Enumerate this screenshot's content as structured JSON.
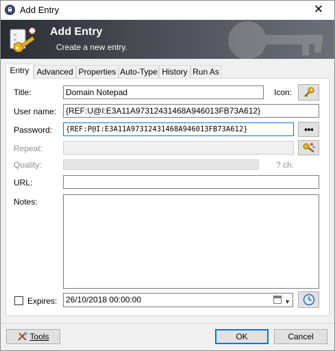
{
  "window": {
    "title": "Add Entry",
    "close_glyph": "✕"
  },
  "banner": {
    "title": "Add Entry",
    "subtitle": "Create a new entry."
  },
  "tabs": [
    "Entry",
    "Advanced",
    "Properties",
    "Auto-Type",
    "History",
    "Run As"
  ],
  "form": {
    "title_label": "Title:",
    "title_value": "Domain Notepad",
    "icon_label": "Icon:",
    "username_label": "User name:",
    "username_value": "{REF:U@I:E3A11A97312431468A946013FB73A612}",
    "password_label": "Password:",
    "password_value": "{REF:P@I:E3A11A97312431468A946013FB73A612}",
    "show_password_glyph": "●●●",
    "repeat_label": "Repeat:",
    "quality_label": "Quality:",
    "quality_chars": "? ch.",
    "url_label": "URL:",
    "url_value": "",
    "notes_label": "Notes:",
    "notes_value": "",
    "expires_label": "Expires:",
    "expires_checked": false,
    "expires_value": "26/10/2018 00:00:00"
  },
  "footer": {
    "tools_label": "Tools",
    "ok_label": "OK",
    "cancel_label": "Cancel"
  },
  "icons": [
    "app-lock-icon",
    "close-icon",
    "key-banner-icon",
    "key-icon",
    "show-password-icon",
    "password-generator-icon",
    "calendar-icon",
    "dropdown-arrow-icon",
    "clock-icon",
    "tools-icon"
  ],
  "colors": {
    "banner_start": "#2b2d33",
    "banner_end": "#6c6f78",
    "focus_border": "#0078d7",
    "key_gold": "#e3b12b"
  }
}
